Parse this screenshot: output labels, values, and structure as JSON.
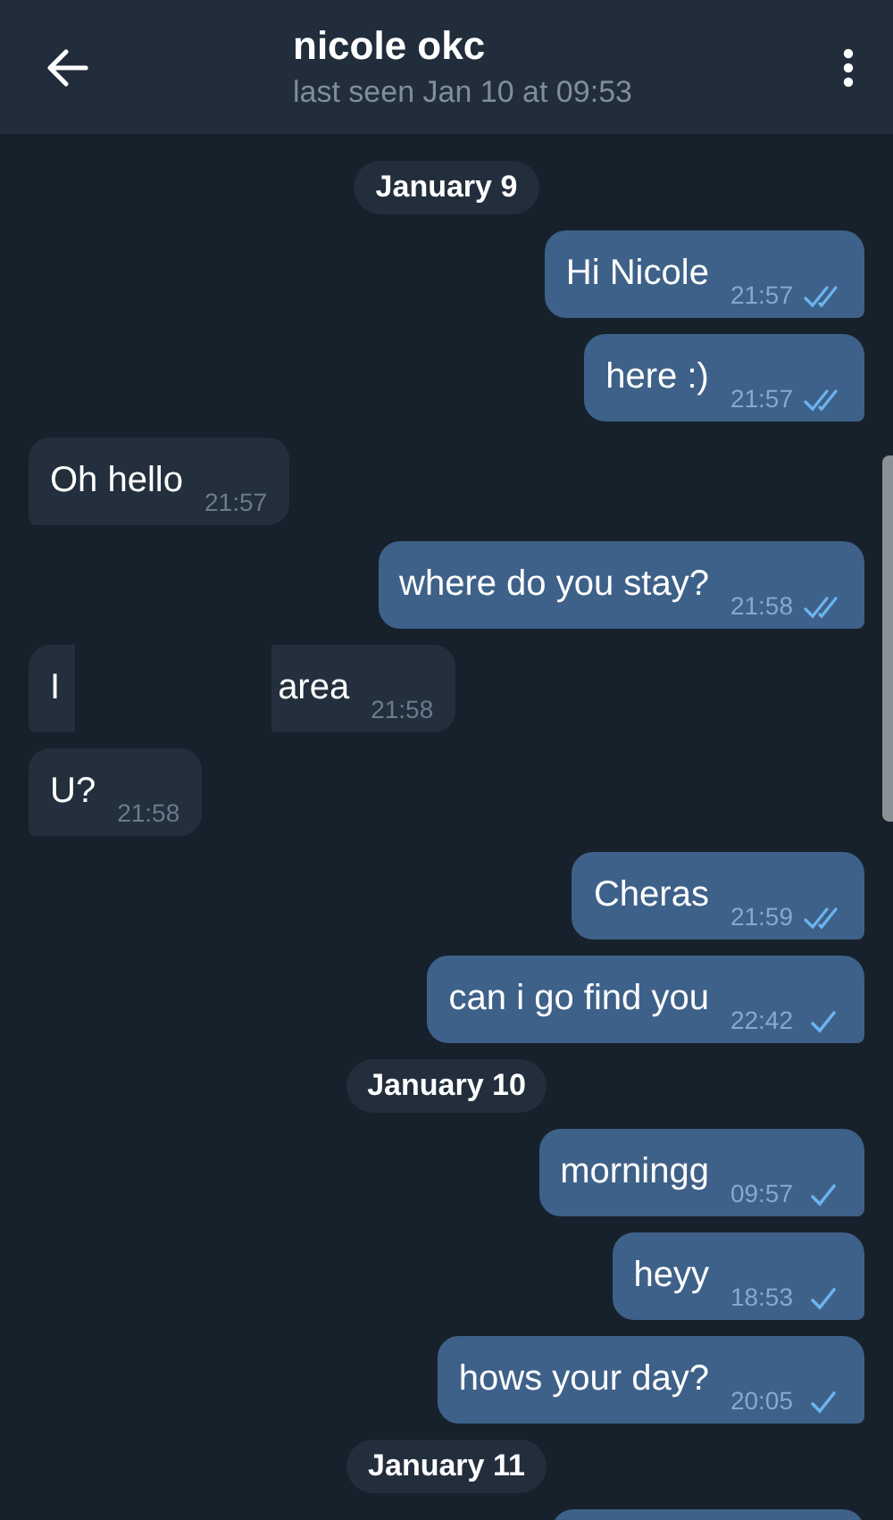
{
  "header": {
    "title": "nicole okc",
    "status": "last seen Jan 10 at 09:53"
  },
  "items": [
    {
      "kind": "date",
      "text": "January 9"
    },
    {
      "kind": "message",
      "outgoing": true,
      "text": "Hi Nicole",
      "time": "21:57",
      "read": true
    },
    {
      "kind": "message",
      "outgoing": true,
      "text": "here :)",
      "time": "21:57",
      "read": true
    },
    {
      "kind": "message",
      "outgoing": false,
      "text": "Oh hello",
      "time": "21:57"
    },
    {
      "kind": "message",
      "outgoing": true,
      "text": "where do you stay?",
      "time": "21:58",
      "read": true
    },
    {
      "kind": "redacted",
      "outgoing": false,
      "text": "I",
      "text_after": "area",
      "time": "21:58"
    },
    {
      "kind": "message",
      "outgoing": false,
      "text": "U?",
      "time": "21:58"
    },
    {
      "kind": "message",
      "outgoing": true,
      "text": "Cheras",
      "time": "21:59",
      "read": true
    },
    {
      "kind": "message",
      "outgoing": true,
      "text": "can i go find you",
      "time": "22:42",
      "read": false
    },
    {
      "kind": "date",
      "text": "January 10"
    },
    {
      "kind": "message",
      "outgoing": true,
      "text": "morningg",
      "time": "09:57",
      "read": false
    },
    {
      "kind": "message",
      "outgoing": true,
      "text": "heyy",
      "time": "18:53",
      "read": false
    },
    {
      "kind": "message",
      "outgoing": true,
      "text": "hows your day?",
      "time": "20:05",
      "read": false
    },
    {
      "kind": "date",
      "text": "January 11"
    },
    {
      "kind": "partial",
      "outgoing": true
    }
  ]
}
